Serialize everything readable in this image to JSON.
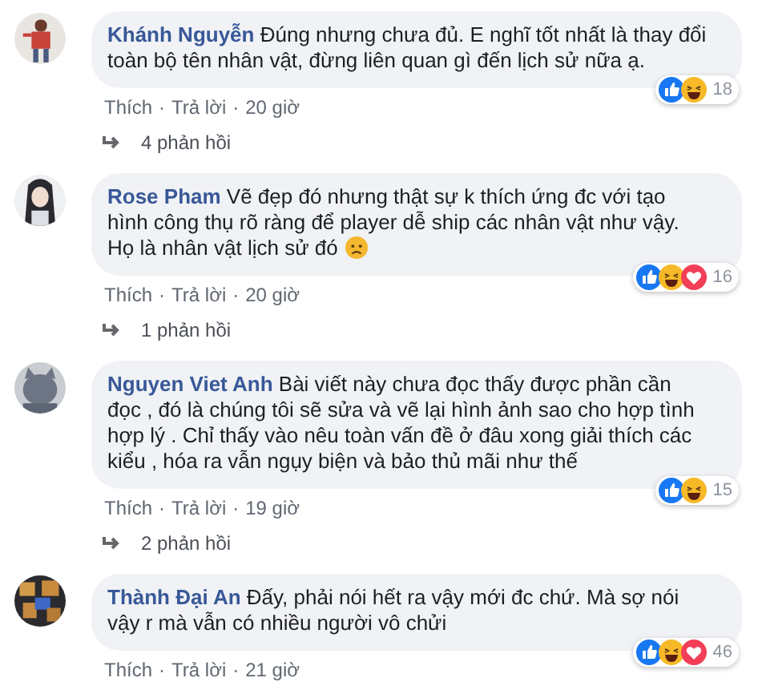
{
  "comments": [
    {
      "author": "Khánh Nguyễn",
      "text": "Đúng nhưng chưa đủ. E nghĩ tốt nhất là thay đổi toàn bộ tên nhân vật, đừng liên quan gì đến lịch sử nữa ạ.",
      "emoji": false,
      "reactions": [
        {
          "kind": "like"
        },
        {
          "kind": "haha"
        }
      ],
      "reaction_count": "18",
      "actions": [
        {
          "kind": "link",
          "text": "Thích"
        },
        {
          "kind": "separator",
          "text": "·"
        },
        {
          "kind": "link",
          "text": "Trả lời"
        },
        {
          "kind": "separator",
          "text": "·"
        },
        {
          "kind": "time",
          "text": "20 giờ"
        }
      ],
      "replies": "4 phản hồi"
    },
    {
      "author": "Rose Pham",
      "text": "Vẽ đẹp đó nhưng thật sự k thích ứng đc với tạo hình công thụ rõ ràng để player dễ ship các nhân vật như vậy. Họ là nhân vật lịch sử đó",
      "emoji": true,
      "reactions": [
        {
          "kind": "like"
        },
        {
          "kind": "haha"
        },
        {
          "kind": "love"
        }
      ],
      "reaction_count": "16",
      "actions": [
        {
          "kind": "link",
          "text": "Thích"
        },
        {
          "kind": "separator",
          "text": "·"
        },
        {
          "kind": "link",
          "text": "Trả lời"
        },
        {
          "kind": "separator",
          "text": "·"
        },
        {
          "kind": "time",
          "text": "20 giờ"
        }
      ],
      "replies": "1 phản hồi"
    },
    {
      "author": "Nguyen Viet Anh",
      "text": "Bài viết này chưa đọc thấy được phần cần đọc , đó là chúng tôi sẽ sửa và vẽ lại hình ảnh sao cho hợp tình hợp lý . Chỉ thấy vào nêu toàn vấn đề ở đâu xong giải thích các kiểu , hóa ra vẫn ngụy biện và bảo thủ mãi như thế",
      "emoji": false,
      "reactions": [
        {
          "kind": "like"
        },
        {
          "kind": "haha"
        }
      ],
      "reaction_count": "15",
      "actions": [
        {
          "kind": "link",
          "text": "Thích"
        },
        {
          "kind": "separator",
          "text": "·"
        },
        {
          "kind": "link",
          "text": "Trả lời"
        },
        {
          "kind": "separator",
          "text": "·"
        },
        {
          "kind": "time",
          "text": "19 giờ"
        }
      ],
      "replies": "2 phản hồi"
    },
    {
      "author": "Thành Đại An",
      "text": "Đấy, phải nói hết ra vậy mới đc chứ. Mà sợ nói vậy r mà vẫn có nhiều người vô chửi",
      "emoji": false,
      "reactions": [
        {
          "kind": "like"
        },
        {
          "kind": "haha"
        },
        {
          "kind": "love"
        }
      ],
      "reaction_count": "46",
      "actions": [
        {
          "kind": "link",
          "text": "Thích"
        },
        {
          "kind": "separator",
          "text": "·"
        },
        {
          "kind": "link",
          "text": "Trả lời"
        },
        {
          "kind": "separator",
          "text": "·"
        },
        {
          "kind": "time",
          "text": "21 giờ"
        }
      ]
    }
  ]
}
